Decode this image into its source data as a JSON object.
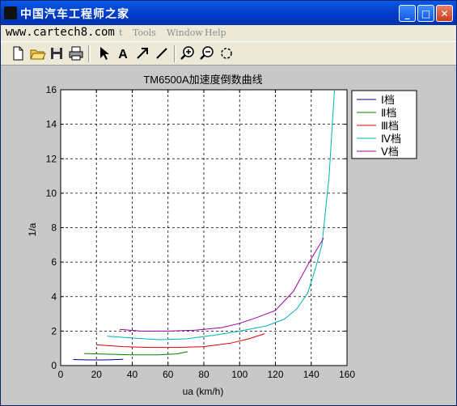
{
  "window": {
    "title": "中国汽车工程师之家",
    "minimize_glyph": "_",
    "maximize_glyph": "□",
    "close_glyph": "✕"
  },
  "watermark": "www.cartech8.com",
  "menu": {
    "items": [
      "t",
      "Tools",
      "Window",
      "Help"
    ]
  },
  "toolbar": {
    "icons": [
      "new-file-icon",
      "open-folder-icon",
      "save-icon",
      "print-icon",
      "pointer-icon",
      "text-icon",
      "arrow-icon",
      "line-icon",
      "zoom-in-icon",
      "zoom-out-icon",
      "rotate-icon"
    ],
    "text_tool_glyph": "A"
  },
  "colors": {
    "series": [
      "#00008b",
      "#008000",
      "#e00000",
      "#00b2b2",
      "#a000a0"
    ]
  },
  "chart_data": {
    "type": "line",
    "title": "TM6500A加速度倒数曲线",
    "xlabel": "ua (km/h)",
    "ylabel": "1/a",
    "xlim": [
      0,
      160
    ],
    "ylim": [
      0,
      16
    ],
    "xticks": [
      0,
      20,
      40,
      60,
      80,
      100,
      120,
      140,
      160
    ],
    "yticks": [
      0,
      2,
      4,
      6,
      8,
      10,
      12,
      14,
      16
    ],
    "grid": true,
    "legend_position": "outside-right",
    "series": [
      {
        "name": "Ⅰ档",
        "x": [
          7,
          15,
          25,
          35
        ],
        "y": [
          0.35,
          0.33,
          0.33,
          0.36
        ]
      },
      {
        "name": "Ⅱ档",
        "x": [
          13,
          25,
          40,
          55,
          65,
          71
        ],
        "y": [
          0.7,
          0.66,
          0.62,
          0.62,
          0.68,
          0.8
        ]
      },
      {
        "name": "Ⅲ档",
        "x": [
          20,
          35,
          50,
          65,
          80,
          95,
          105,
          114
        ],
        "y": [
          1.2,
          1.1,
          1.05,
          1.05,
          1.1,
          1.3,
          1.55,
          1.85
        ]
      },
      {
        "name": "Ⅳ档",
        "x": [
          26,
          40,
          55,
          70,
          85,
          100,
          115,
          125,
          132,
          138,
          142,
          146,
          150,
          153
        ],
        "y": [
          1.7,
          1.6,
          1.5,
          1.55,
          1.75,
          2.0,
          2.3,
          2.7,
          3.3,
          4.2,
          5.5,
          7.0,
          11.0,
          16.0
        ]
      },
      {
        "name": "Ⅴ档",
        "x": [
          33,
          45,
          60,
          75,
          90,
          100,
          110,
          120,
          130,
          140,
          147
        ],
        "y": [
          2.1,
          2.0,
          2.0,
          2.05,
          2.2,
          2.45,
          2.8,
          3.2,
          4.3,
          6.2,
          7.4
        ]
      }
    ]
  }
}
